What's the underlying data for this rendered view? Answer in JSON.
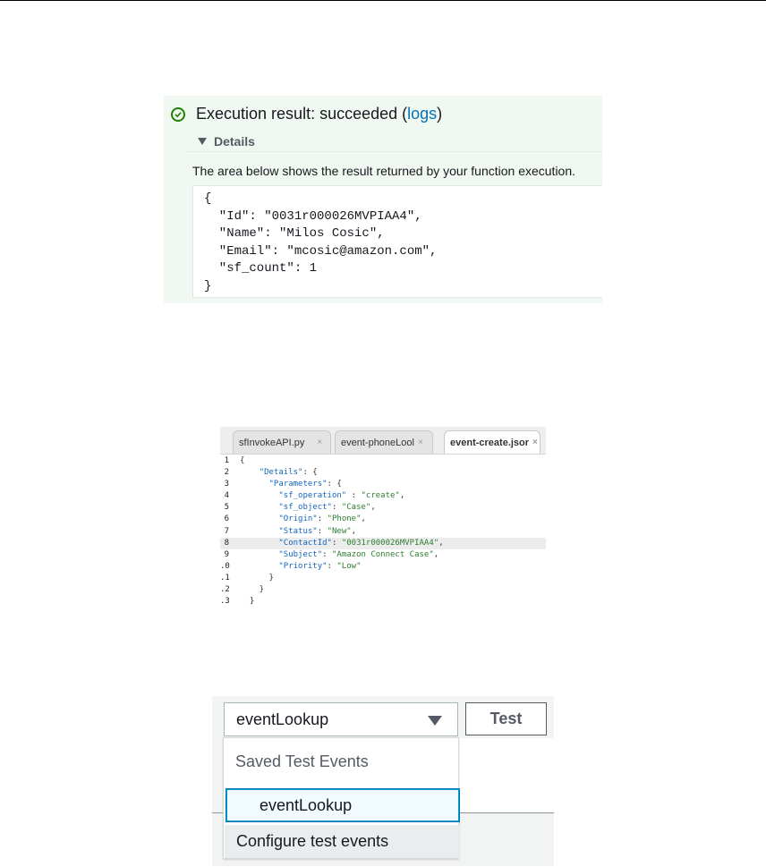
{
  "result": {
    "title_prefix": "Execution result: succeeded (",
    "logs_link": "logs",
    "title_suffix": ")",
    "details_label": "Details",
    "description": "The area below shows the result returned by your function execution.",
    "output_lines": [
      "{",
      "  \"Id\": \"0031r000026MVPIAA4\",",
      "  \"Name\": \"Milos Cosic\",",
      "  \"Email\": \"mcosic@amazon.com\",",
      "  \"sf_count\": 1",
      "}"
    ],
    "status_color": "#1d8102",
    "link_color": "#0073bb"
  },
  "editor": {
    "tabs": [
      {
        "label": "sfInvokeAPI.py",
        "active": false
      },
      {
        "label": "event-phoneLool",
        "active": false
      },
      {
        "label": "event-create.jsor",
        "active": true
      }
    ],
    "close_glyph": "×",
    "lines": [
      {
        "num": "1",
        "text": "{"
      },
      {
        "num": "2",
        "text": "    \"Details\": {"
      },
      {
        "num": "3",
        "text": "      \"Parameters\": {"
      },
      {
        "num": "4",
        "text": "        \"sf_operation\" : \"create\","
      },
      {
        "num": "5",
        "text": "        \"sf_object\": \"Case\","
      },
      {
        "num": "6",
        "text": "        \"Origin\": \"Phone\","
      },
      {
        "num": "7",
        "text": "        \"Status\": \"New\","
      },
      {
        "num": "8",
        "text": "        \"ContactId\": \"0031r000026MVPIAA4\",",
        "highlight": true
      },
      {
        "num": "9",
        "text": "        \"Subject\": \"Amazon Connect Case\","
      },
      {
        "num": ".0",
        "text": "        \"Priority\": \"Low\""
      },
      {
        "num": ".1",
        "text": "      }"
      },
      {
        "num": ".2",
        "text": "    }"
      },
      {
        "num": ".3",
        "text": "  }"
      }
    ]
  },
  "test": {
    "selected_event": "eventLookup",
    "test_button": "Test",
    "menu_group_label": "Saved Test Events",
    "menu_item": "eventLookup",
    "configure_label": "Configure test events"
  }
}
